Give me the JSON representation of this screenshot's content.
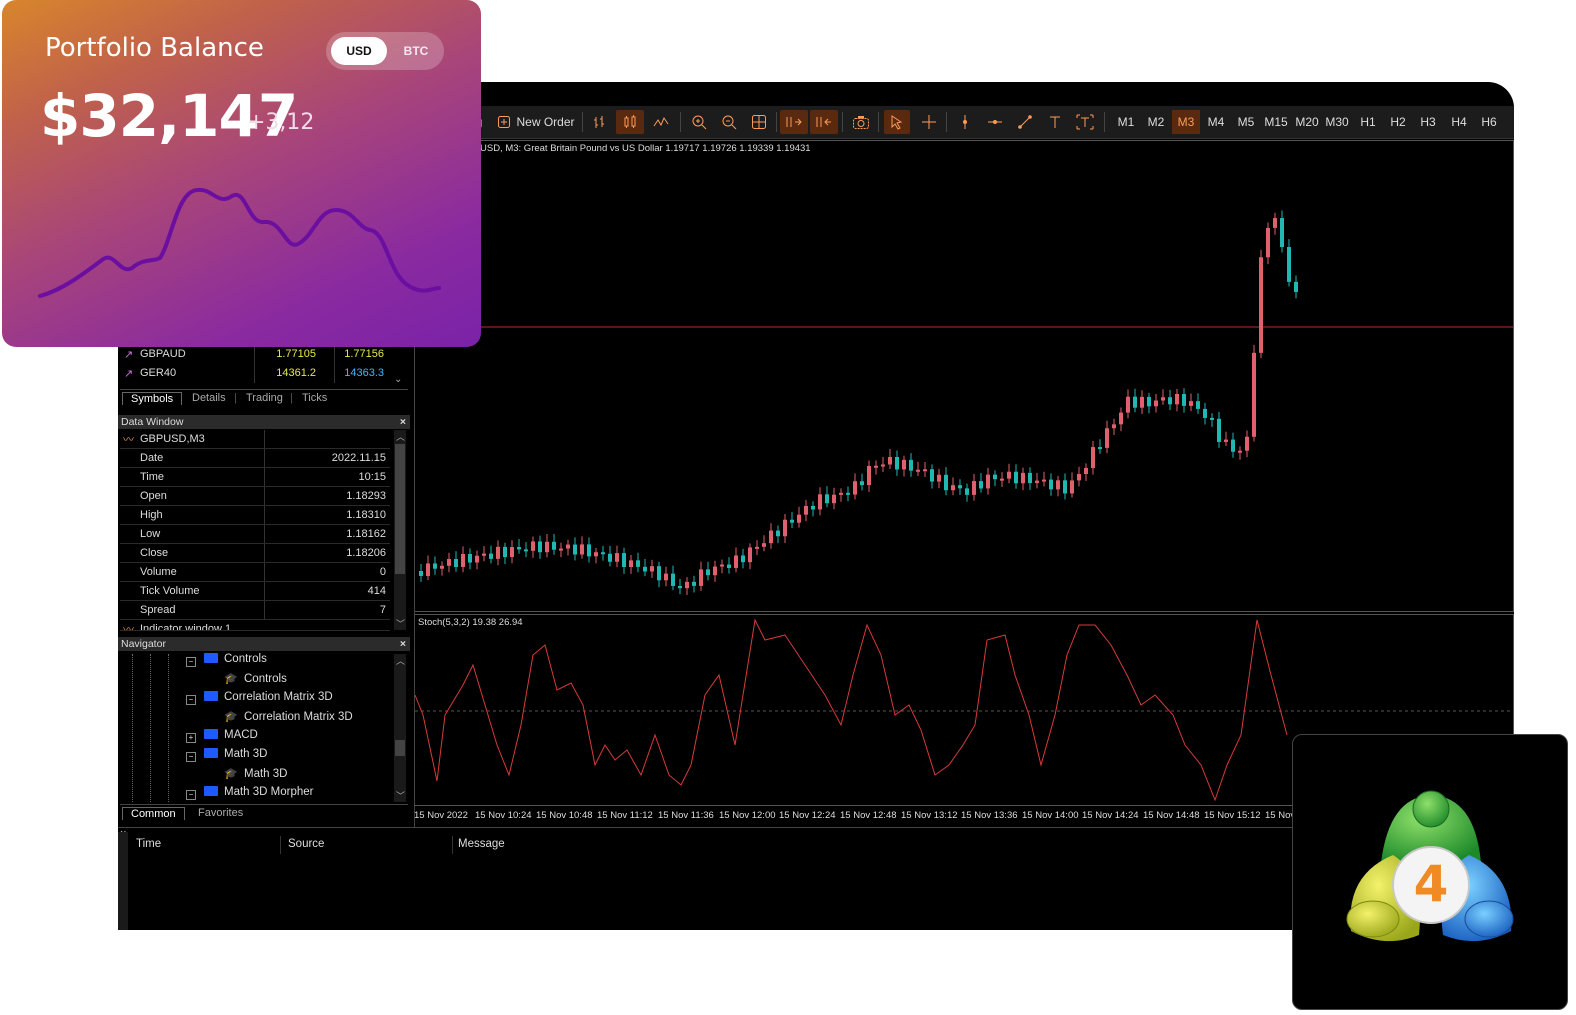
{
  "toolbar": {
    "new_order_label": "New Order",
    "partial_left_label": "g",
    "icons": [
      "new-order-icon",
      "bar-chart-icon",
      "candlestick-icon",
      "line-chart-icon",
      "zoom-in-icon",
      "zoom-out-icon",
      "grid-icon",
      "autoscroll-icon",
      "chart-shift-icon",
      "screenshot-icon",
      "cursor-icon",
      "crosshair-icon",
      "vertical-line-icon",
      "horizontal-line-icon",
      "trendline-icon",
      "text-icon",
      "text-label-icon"
    ],
    "timeframes": [
      "M1",
      "M2",
      "M3",
      "M4",
      "M5",
      "M15",
      "M20",
      "M30",
      "H1",
      "H2",
      "H3",
      "H4",
      "H6"
    ],
    "active_timeframe": "M3"
  },
  "market_watch": {
    "rows": [
      {
        "symbol": "GBPAUD",
        "bid": "1.77105",
        "ask": "1.77156"
      },
      {
        "symbol": "GER40",
        "bid": "14361.2",
        "ask": "14363.3"
      }
    ],
    "tabs": [
      "Symbols",
      "Details",
      "Trading",
      "Ticks"
    ],
    "active_tab": "Symbols"
  },
  "data_window": {
    "title": "Data Window",
    "close": "×",
    "symbol": "GBPUSD,M3",
    "rows": [
      {
        "key": "Date",
        "value": "2022.11.15"
      },
      {
        "key": "Time",
        "value": "10:15"
      },
      {
        "key": "Open",
        "value": "1.18293"
      },
      {
        "key": "High",
        "value": "1.18310"
      },
      {
        "key": "Low",
        "value": "1.18162"
      },
      {
        "key": "Close",
        "value": "1.18206"
      },
      {
        "key": "Volume",
        "value": "0"
      },
      {
        "key": "Tick Volume",
        "value": "414"
      },
      {
        "key": "Spread",
        "value": "7"
      }
    ],
    "cut_row": "Indicator window 1"
  },
  "navigator": {
    "title": "Navigator",
    "close": "×",
    "items": [
      {
        "label": "Controls",
        "kind": "folder"
      },
      {
        "label": "Controls",
        "kind": "program"
      },
      {
        "label": "Correlation Matrix 3D",
        "kind": "folder"
      },
      {
        "label": "Correlation Matrix 3D",
        "kind": "program"
      },
      {
        "label": "MACD",
        "kind": "folder"
      },
      {
        "label": "Math 3D",
        "kind": "folder"
      },
      {
        "label": "Math 3D",
        "kind": "program"
      },
      {
        "label": "Math 3D Morpher",
        "kind": "folder"
      }
    ],
    "tabs": [
      "Common",
      "Favorites"
    ],
    "active_tab": "Common"
  },
  "chart": {
    "title": "USD, M3:  Great Britain Pound vs US Dollar  1.19717 1.19726 1.19339 1.19431",
    "oscillator_title": "Stoch(5,3,2) 19.38 26.94",
    "time_labels": [
      "15 Nov 2022",
      "15 Nov 10:24",
      "15 Nov 10:48",
      "15 Nov 11:12",
      "15 Nov 11:36",
      "15 Nov 12:00",
      "15 Nov 12:24",
      "15 Nov 12:48",
      "15 Nov 13:12",
      "15 Nov 13:36",
      "15 Nov 14:00",
      "15 Nov 14:24",
      "15 Nov 14:48",
      "15 Nov 15:12",
      "15 Nov"
    ],
    "colors": {
      "bull": "#e0606e",
      "bear": "#1fb8b2",
      "stoch": "#d83a3a",
      "price_line": "#b03030"
    }
  },
  "log": {
    "columns": [
      "Time",
      "Source",
      "Message"
    ],
    "close": "×"
  },
  "balance_card": {
    "title": "Portfolio Balance",
    "currency_options": [
      "USD",
      "BTC"
    ],
    "selected_currency": "USD",
    "amount": "$32,147",
    "change": "+3,12"
  },
  "logo": {
    "name": "metatrader-4-logo",
    "number": "4"
  }
}
